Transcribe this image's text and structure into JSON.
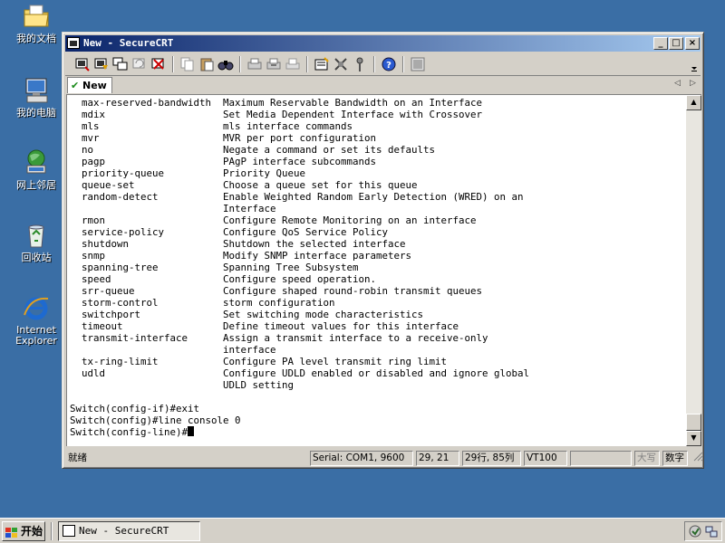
{
  "desktop": {
    "icons": [
      {
        "label": "我的文档",
        "icon": "folder-icon"
      },
      {
        "label": "我的电脑",
        "icon": "computer-icon"
      },
      {
        "label": "网上邻居",
        "icon": "network-icon"
      },
      {
        "label": "回收站",
        "icon": "recycle-bin-icon"
      },
      {
        "label": "Internet Explorer",
        "label_line1": "Internet",
        "label_line2": "Explorer",
        "icon": "ie-icon"
      }
    ]
  },
  "window": {
    "title": "New - SecureCRT",
    "controls": {
      "minimize": "_",
      "maximize": "□",
      "close": "×"
    },
    "tab_label": "New"
  },
  "terminal": {
    "lines": [
      "  max-reserved-bandwidth  Maximum Reservable Bandwidth on an Interface",
      "  mdix                    Set Media Dependent Interface with Crossover",
      "  mls                     mls interface commands",
      "  mvr                     MVR per port configuration",
      "  no                      Negate a command or set its defaults",
      "  pagp                    PAgP interface subcommands",
      "  priority-queue          Priority Queue",
      "  queue-set               Choose a queue set for this queue",
      "  random-detect           Enable Weighted Random Early Detection (WRED) on an",
      "                          Interface",
      "  rmon                    Configure Remote Monitoring on an interface",
      "  service-policy          Configure QoS Service Policy",
      "  shutdown                Shutdown the selected interface",
      "  snmp                    Modify SNMP interface parameters",
      "  spanning-tree           Spanning Tree Subsystem",
      "  speed                   Configure speed operation.",
      "  srr-queue               Configure shaped round-robin transmit queues",
      "  storm-control           storm configuration",
      "  switchport              Set switching mode characteristics",
      "  timeout                 Define timeout values for this interface",
      "  transmit-interface      Assign a transmit interface to a receive-only",
      "                          interface",
      "  tx-ring-limit           Configure PA level transmit ring limit",
      "  udld                    Configure UDLD enabled or disabled and ignore global",
      "                          UDLD setting",
      "",
      "Switch(config-if)#exit",
      "Switch(config)#line console 0"
    ],
    "prompt": "Switch(config-line)#"
  },
  "statusbar": {
    "ready": "就绪",
    "serial": "Serial: COM1, 9600",
    "cursor_pos": "29, 21",
    "rows_cols": "29行, 85列",
    "terminal_type": "VT100",
    "caps": "大写",
    "num": "数字"
  },
  "taskbar": {
    "start_label": "开始",
    "task_item": "New - SecureCRT"
  },
  "colors": {
    "desktop": "#3a6ea5",
    "title_start": "#0a246a",
    "title_end": "#a6caf0",
    "chrome": "#d4d0c8"
  }
}
